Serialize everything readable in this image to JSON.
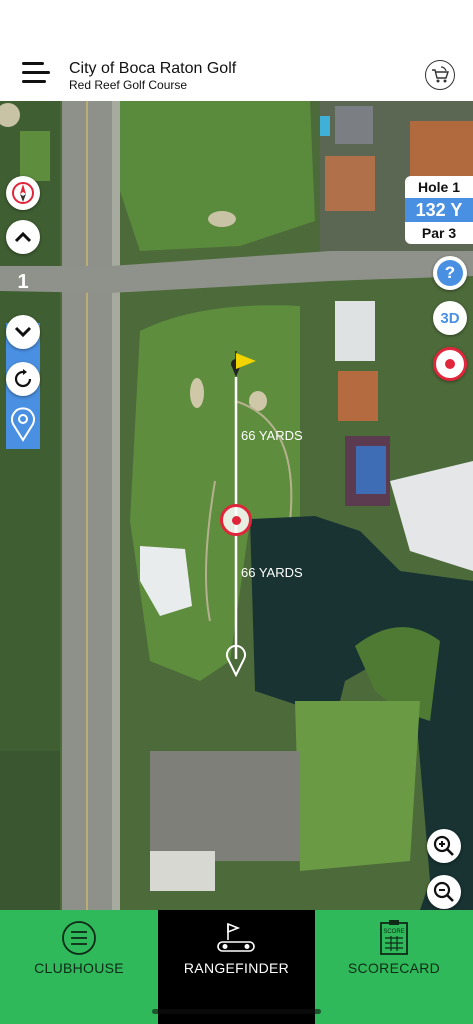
{
  "header": {
    "title": "City of Boca Raton Golf",
    "subtitle": "Red Reef Golf Course"
  },
  "hole_info": {
    "hole": "Hole 1",
    "yardage": "132 Y",
    "par": "Par 3"
  },
  "left_controls": {
    "hole_number": "1"
  },
  "right_controls": {
    "three_d_label": "3D",
    "help_label": "?"
  },
  "rangefinder": {
    "upper_distance": "66 YARDS",
    "lower_distance": "66 YARDS"
  },
  "tabs": [
    {
      "label": "CLUBHOUSE",
      "icon": "list-icon"
    },
    {
      "label": "RANGEFINDER",
      "icon": "golf-cart-flag-icon"
    },
    {
      "label": "SCORECARD",
      "icon": "scorecard-icon"
    }
  ],
  "scorecard_icon_text": "SCORE",
  "colors": {
    "accent_blue": "#4a90e2",
    "tab_green": "#2fb95a",
    "target_red": "#e0263a",
    "flag_yellow": "#f2d500"
  }
}
